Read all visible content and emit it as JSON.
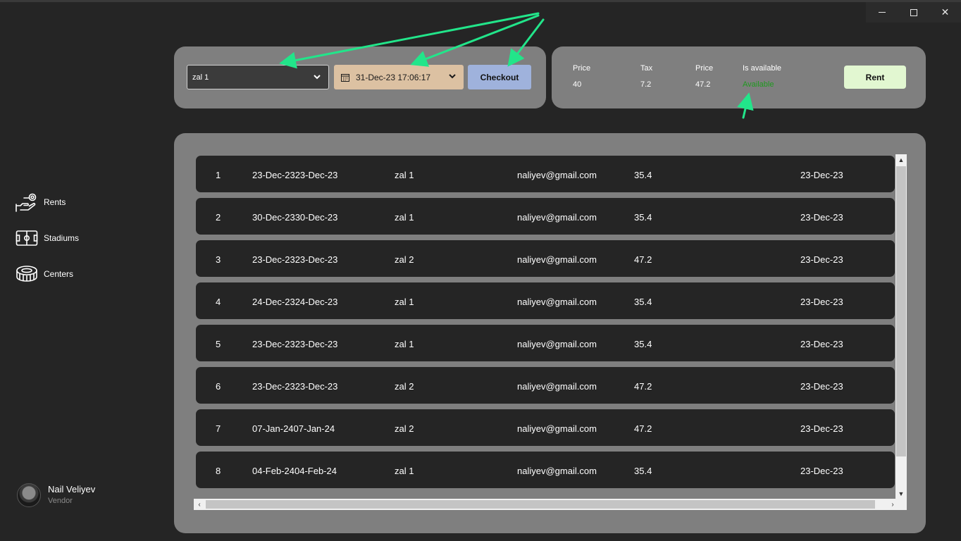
{
  "window": {
    "controls": {
      "minimize": "minimize-icon",
      "maximize": "maximize-icon",
      "close": "✕"
    }
  },
  "sidebar": {
    "items": [
      {
        "label": "Rents",
        "icon": "hand-coin-icon"
      },
      {
        "label": "Stadiums",
        "icon": "football-field-icon"
      },
      {
        "label": "Centers",
        "icon": "stadium-icon"
      }
    ],
    "user": {
      "name": "Nail Veliyev",
      "role": "Vendor"
    }
  },
  "booking": {
    "hall_select": {
      "value": "zal 1"
    },
    "date_picker": {
      "value": "31-Dec-23 17:06:17"
    },
    "checkout_label": "Checkout"
  },
  "summary": {
    "price_label": "Price",
    "price_value": "40",
    "tax_label": "Tax",
    "tax_value": "7.2",
    "total_label": "Price",
    "total_value": "47.2",
    "availability_label": "Is available",
    "availability_value": "Available",
    "rent_label": "Rent"
  },
  "table": {
    "rows": [
      {
        "id": "1",
        "dates": "23-Dec-2323-Dec-23",
        "hall": "zal 1",
        "email": "naliyev@gmail.com",
        "price": "35.4",
        "created": "23-Dec-23"
      },
      {
        "id": "2",
        "dates": "30-Dec-2330-Dec-23",
        "hall": "zal 1",
        "email": "naliyev@gmail.com",
        "price": "35.4",
        "created": "23-Dec-23"
      },
      {
        "id": "3",
        "dates": "23-Dec-2323-Dec-23",
        "hall": "zal 2",
        "email": "naliyev@gmail.com",
        "price": "47.2",
        "created": "23-Dec-23"
      },
      {
        "id": "4",
        "dates": "24-Dec-2324-Dec-23",
        "hall": "zal 1",
        "email": "naliyev@gmail.com",
        "price": "35.4",
        "created": "23-Dec-23"
      },
      {
        "id": "5",
        "dates": "23-Dec-2323-Dec-23",
        "hall": "zal 1",
        "email": "naliyev@gmail.com",
        "price": "35.4",
        "created": "23-Dec-23"
      },
      {
        "id": "6",
        "dates": "23-Dec-2323-Dec-23",
        "hall": "zal 2",
        "email": "naliyev@gmail.com",
        "price": "47.2",
        "created": "23-Dec-23"
      },
      {
        "id": "7",
        "dates": "07-Jan-2407-Jan-24",
        "hall": "zal 2",
        "email": "naliyev@gmail.com",
        "price": "47.2",
        "created": "23-Dec-23"
      },
      {
        "id": "8",
        "dates": "04-Feb-2404-Feb-24",
        "hall": "zal 1",
        "email": "naliyev@gmail.com",
        "price": "35.4",
        "created": "23-Dec-23"
      }
    ]
  },
  "colors": {
    "background": "#252525",
    "panel": "#7f7f7f",
    "checkout": "#9fb2dc",
    "datepicker": "#dcc1a2",
    "rent": "#e2f7d1",
    "available": "#1f9a1f",
    "annotation_arrows": "#22e58a"
  }
}
